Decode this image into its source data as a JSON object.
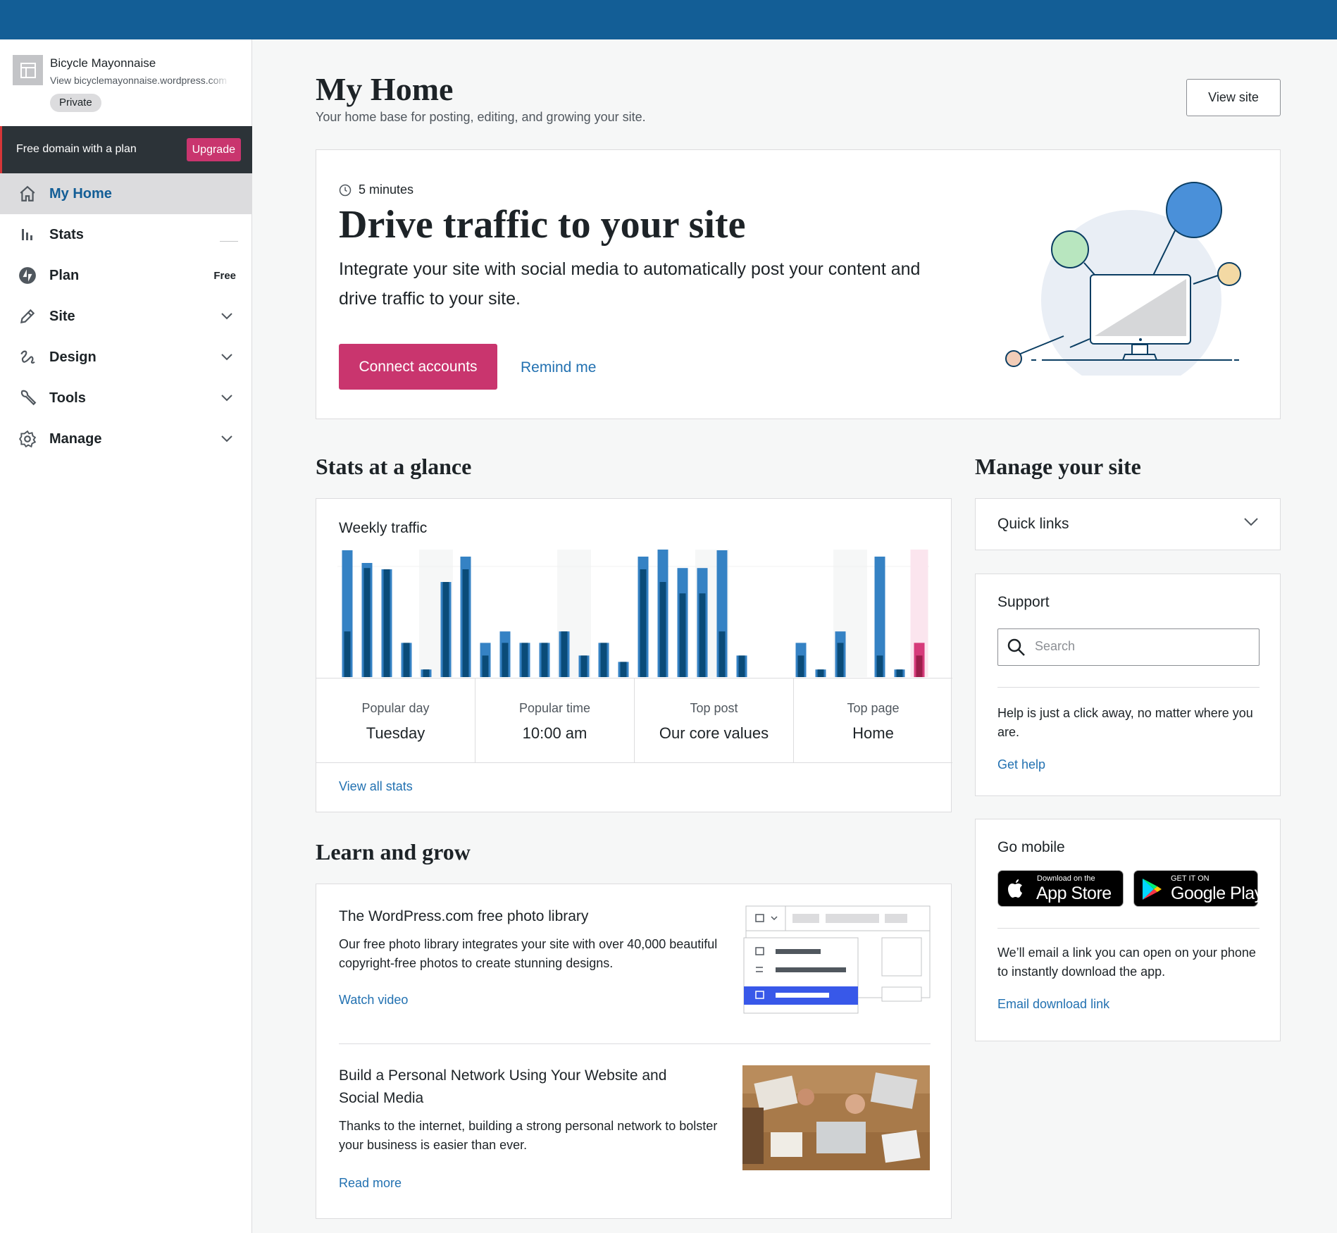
{
  "sidebar": {
    "site_name": "Bicycle Mayonnaise",
    "site_url": "View bicyclemayonnaise.wordpress.com",
    "privacy_badge": "Private",
    "upsell_text": "Free domain with a plan",
    "upgrade_label": "Upgrade",
    "items": [
      {
        "label": "My Home",
        "icon": "house-icon",
        "active": true
      },
      {
        "label": "Stats",
        "icon": "bar-chart-icon"
      },
      {
        "label": "Plan",
        "icon": "jetpack-bolt-icon",
        "badge": "Free"
      },
      {
        "label": "Site",
        "icon": "pencil-icon"
      },
      {
        "label": "Design",
        "icon": "brush-icon"
      },
      {
        "label": "Tools",
        "icon": "wrench-icon"
      },
      {
        "label": "Manage",
        "icon": "gear-icon"
      }
    ]
  },
  "header": {
    "title": "My Home",
    "subtitle": "Your home base for posting, editing, and growing your site.",
    "view_site_label": "View site"
  },
  "task": {
    "duration": "5 minutes",
    "title": "Drive traffic to your site",
    "description": "Integrate your site with social media to automatically post your content and drive traffic to your site.",
    "primary_label": "Connect accounts",
    "secondary_label": "Remind me"
  },
  "stats": {
    "section_title": "Stats at a glance",
    "card_title": "Weekly traffic",
    "highlights": [
      {
        "label": "Popular day",
        "value": "Tuesday"
      },
      {
        "label": "Popular time",
        "value": "10:00 am"
      },
      {
        "label": "Top post",
        "value": "Our core values"
      },
      {
        "label": "Top page",
        "value": "Home"
      }
    ],
    "view_all_label": "View all stats"
  },
  "chart_data": {
    "type": "bar",
    "title": "Weekly traffic",
    "series": [
      {
        "name": "",
        "values": [
          10,
          9,
          8.5,
          2.7,
          0.6,
          7.5,
          9.5,
          2.7,
          3.6,
          2.7,
          2.7,
          3.6,
          1.7,
          2.7,
          1.2,
          9.5,
          10.6,
          8.6,
          8.6,
          10,
          1.7,
          0,
          0,
          2.7,
          0.6,
          3.6,
          0,
          9.5,
          0.6,
          2.7
        ]
      },
      {
        "name": "",
        "values": [
          3.6,
          8.6,
          8.5,
          2.7,
          0.6,
          7.5,
          8.5,
          1.7,
          2.7,
          2.7,
          2.7,
          3.6,
          1.7,
          2.7,
          1.2,
          8.5,
          7.5,
          6.6,
          6.6,
          3.6,
          1.7,
          0,
          0,
          1.7,
          0.6,
          2.7,
          0,
          1.7,
          0.6,
          1.7
        ]
      }
    ],
    "highlight_index": 29,
    "ylim": [
      0,
      10
    ]
  },
  "learn": {
    "section_title": "Learn and grow",
    "items": [
      {
        "title": "The WordPress.com free photo library",
        "description": "Our free photo library integrates your site with over 40,000 beautiful copyright-free photos to create stunning designs.",
        "link": "Watch video"
      },
      {
        "title": "Build a Personal Network Using Your Website and Social Media",
        "description": "Thanks to the internet, building a strong personal network to bolster your business is easier than ever.",
        "link": "Read more"
      }
    ]
  },
  "manage": {
    "section_title": "Manage your site",
    "quick_links_label": "Quick links"
  },
  "support": {
    "title": "Support",
    "search_placeholder": "Search",
    "description": "Help is just a click away, no matter where you are.",
    "link": "Get help"
  },
  "mobile": {
    "title": "Go mobile",
    "appstore_small": "Download on the",
    "appstore_big": "App Store",
    "gplay_small": "GET IT ON",
    "gplay_big": "Google Play",
    "description": "We’ll email a link you can open on your phone to instantly download the app.",
    "link": "Email download link"
  },
  "colors": {
    "masterbar": "#135e96",
    "accent_pink": "#c9356e",
    "link_blue": "#2271b1",
    "bar_light": "#3582c4",
    "bar_dark": "#0a4b78"
  }
}
